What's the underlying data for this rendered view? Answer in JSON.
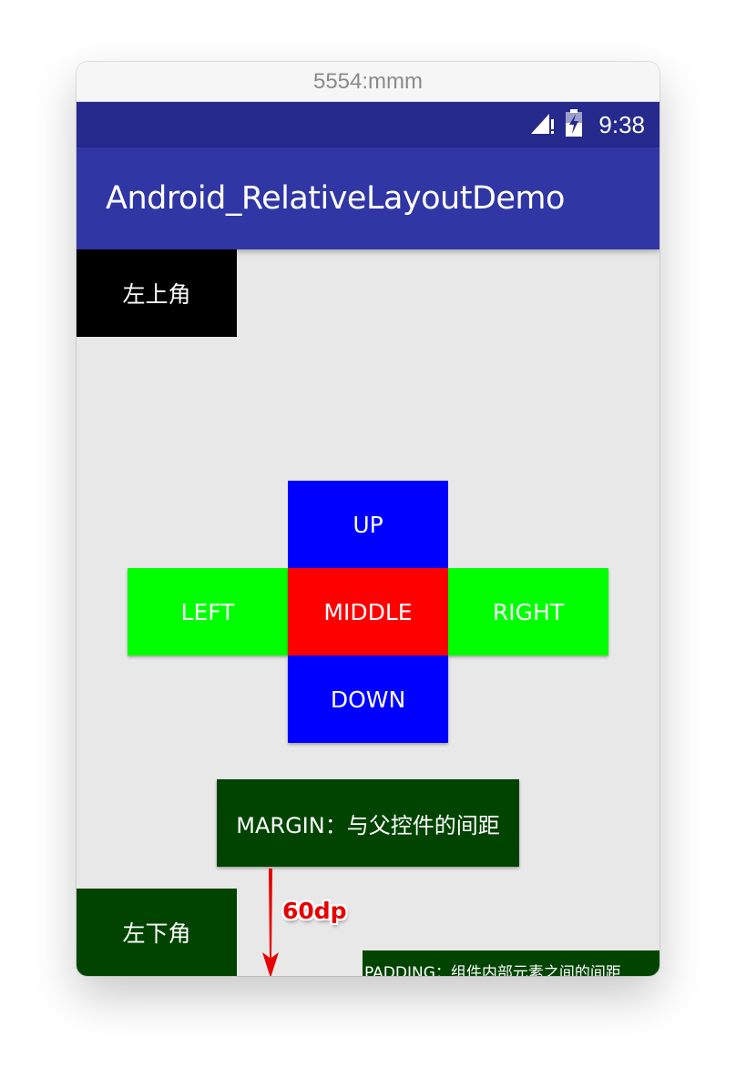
{
  "window": {
    "title": "5554:mmm"
  },
  "status_bar": {
    "time": "9:38",
    "icons": [
      "signal-icon",
      "battery-icon"
    ]
  },
  "app_bar": {
    "title": "Android_RelativeLayoutDemo"
  },
  "layout": {
    "top_left_label": "左上角",
    "up_label": "UP",
    "left_label": "LEFT",
    "middle_label": "MIDDLE",
    "right_label": "RIGHT",
    "down_label": "DOWN",
    "margin_label": "MARGIN：与父控件的间距",
    "bottom_left_label": "左下角",
    "padding_label": "PADDING：组件内部元素之间的间距"
  },
  "annotation": {
    "label": "60dp"
  },
  "colors": {
    "status_bar": "#252a8c",
    "app_bar": "#3036a4",
    "top_left": "#000000",
    "up_down": "#0000ff",
    "left_right": "#00ff00",
    "middle": "#ff0000",
    "dark_green": "#004400",
    "annotation_arrow": "#e60000"
  }
}
